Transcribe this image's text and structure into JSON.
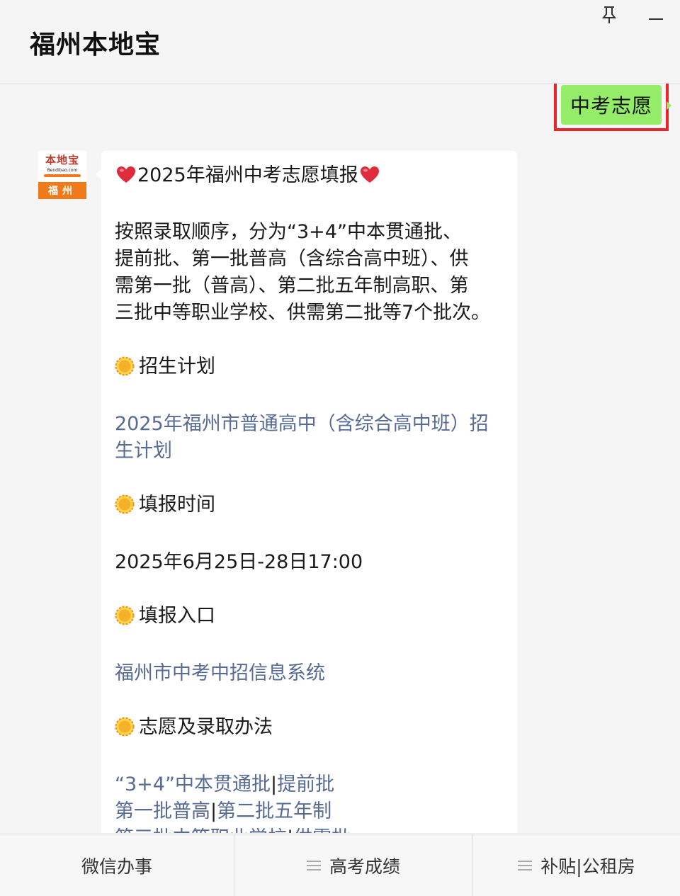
{
  "window": {
    "title": "福州本地宝",
    "pin_icon": "pin-icon",
    "minimize_icon": "minimize-icon"
  },
  "chat": {
    "sent_message": "中考志愿",
    "avatar": {
      "logo_text": "本地宝",
      "logo_sub": "Bendibao.com",
      "city": "福州"
    },
    "message": {
      "headline": "2025年福州中考志愿填报",
      "intro_lines": [
        "按照录取顺序，分为“3+4”中本贯通批、",
        "提前批、第一批普高（含综合高中班）、供",
        "需第一批（普高）、第二批五年制高职、第",
        "三批中等职业学校、供需第二批等7个批次。"
      ],
      "section_plan": "招生计划",
      "plan_link_lines": [
        "2025年福州市普通高中（含综合高中班）招",
        "生计划"
      ],
      "section_time": "填报时间",
      "time_value": "2025年6月25日-28日17:00",
      "section_entry": "填报入口",
      "entry_link": "福州市中考中招信息系统",
      "section_method": "志愿及录取办法",
      "method_links": {
        "batch_34": "“3+4”中本贯通批",
        "early": "提前批",
        "first": "第一批普高",
        "second": "第二批五年制",
        "third": "第三批中等职业学校",
        "supply": "供需批",
        "separator": "|"
      }
    }
  },
  "menu": {
    "items": [
      {
        "label": "微信办事",
        "has_submenu": false
      },
      {
        "label": "高考成绩",
        "has_submenu": true
      },
      {
        "label": "补贴|公租房",
        "has_submenu": true
      }
    ]
  },
  "colors": {
    "sent_bubble": "#95ec69",
    "highlight_box": "#e8262a",
    "link": "#576b95",
    "heart": "#e02b3c",
    "sun": "#f5b12a",
    "logo_orange": "#f07a1a"
  }
}
